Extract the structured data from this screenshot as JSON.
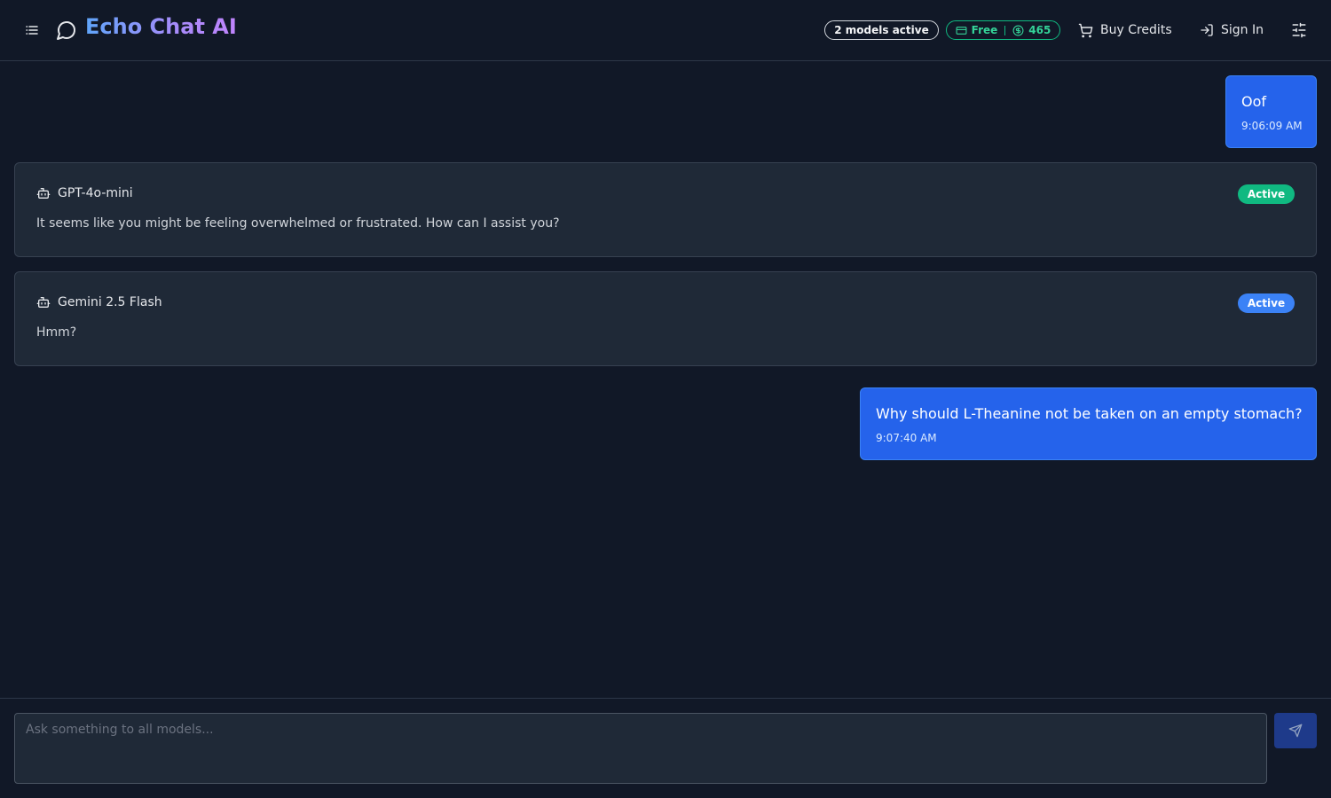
{
  "app": {
    "title": "Echo Chat AI"
  },
  "header": {
    "models_active": "2 models active",
    "plan": "Free",
    "credits": "465",
    "buy_credits": "Buy Credits",
    "sign_in": "Sign In"
  },
  "messages": [
    {
      "role": "user",
      "text": "Oof",
      "time": "9:06:09 AM"
    },
    {
      "role": "model",
      "model": "GPT-4o-mini",
      "status": "Active",
      "status_color": "#10b981",
      "text": "It seems like you might be feeling overwhelmed or frustrated. How can I assist you?"
    },
    {
      "role": "model",
      "model": "Gemini 2.5 Flash",
      "status": "Active",
      "status_color": "#3b82f6",
      "text": "Hmm?"
    },
    {
      "role": "user",
      "text": "Why should L-Theanine not be taken on an empty stomach?",
      "time": "9:07:40 AM"
    }
  ],
  "composer": {
    "placeholder": "Ask something to all models..."
  },
  "colors": {
    "background": "#111827",
    "accent": "#2563eb",
    "card": "#1f2937",
    "success": "#10b981"
  },
  "icons": [
    "list-icon",
    "chat-bubble-icon",
    "credit-card-icon",
    "dollar-icon",
    "cart-icon",
    "sign-in-icon",
    "sliders-icon",
    "bot-icon",
    "send-icon"
  ]
}
